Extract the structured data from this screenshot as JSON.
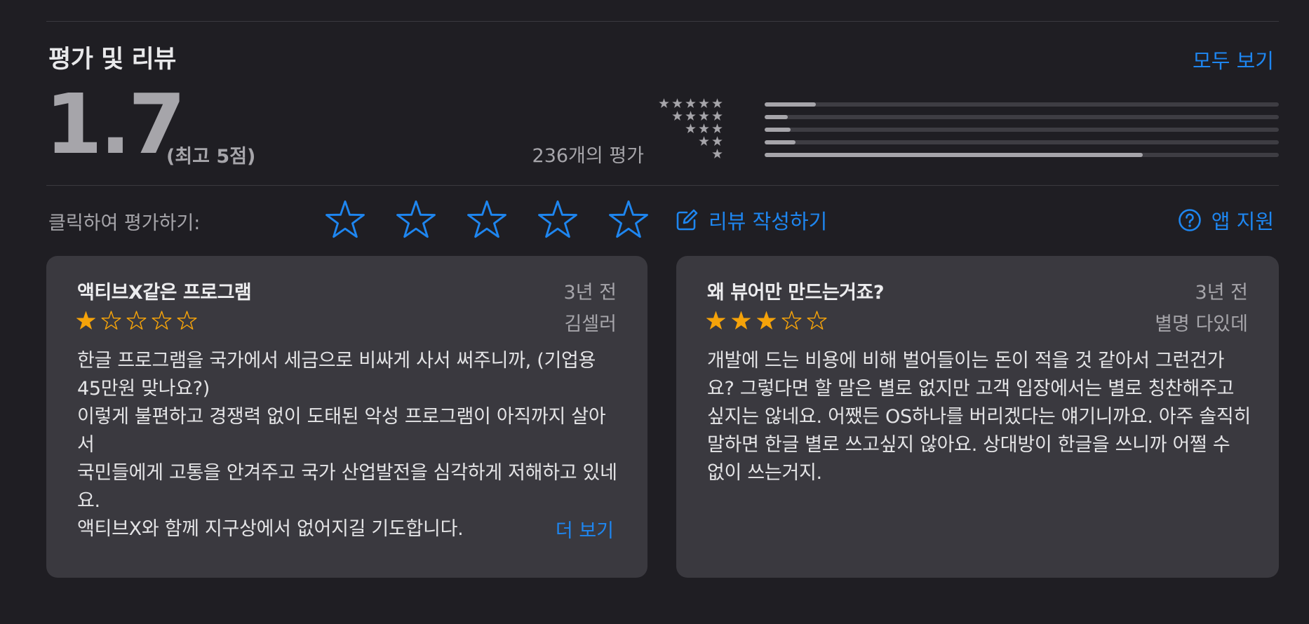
{
  "section": {
    "title": "평가 및 리뷰",
    "see_all": "모두 보기"
  },
  "summary": {
    "rating": "1.7",
    "out_of": "(최고 5점)",
    "count": "236개의 평가"
  },
  "histogram": [
    {
      "stars": 5,
      "fraction": 0.1
    },
    {
      "stars": 4,
      "fraction": 0.045
    },
    {
      "stars": 3,
      "fraction": 0.05
    },
    {
      "stars": 2,
      "fraction": 0.06
    },
    {
      "stars": 1,
      "fraction": 0.735
    }
  ],
  "tap_to_rate": {
    "label": "클릭하여 평가하기:",
    "max_stars": 5
  },
  "actions": {
    "write_review": "리뷰 작성하기",
    "app_support": "앱 지원"
  },
  "colors": {
    "accent": "#1e86f0",
    "star_orange": "#f5a30a",
    "bar_fill": "#a6a5aa",
    "bar_track": "#3e3d43",
    "card_bg": "#3a393f",
    "page_bg": "#1f1e23"
  },
  "reviews": [
    {
      "title": "액티브X같은 프로그램",
      "date": "3년 전",
      "author": "김셀러",
      "rating": 1,
      "body": "한글 프로그램을 국가에서 세금으로 비싸게 사서 써주니까, (기업용 45만원 맞나요?)\n이렇게 불편하고 경쟁력 없이 도태된 악성 프로그램이 아직까지 살아서\n국민들에게 고통을 안겨주고 국가 산업발전을 심각하게 저해하고 있네요.\n액티브X와 함께 지구상에서 없어지길 기도합니다.",
      "more": "더 보기"
    },
    {
      "title": "왜 뷰어만 만드는거죠?",
      "date": "3년 전",
      "author": "별명 다있데",
      "rating": 3,
      "body": "개발에 드는 비용에 비해 벌어들이는 돈이 적을 것 같아서 그런건가요? 그렇다면 할 말은 별로 없지만 고객 입장에서는 별로 칭찬해주고 싶지는 않네요. 어쨌든 OS하나를 버리겠다는 얘기니까요. 아주 솔직히 말하면 한글 별로 쓰고싶지 않아요. 상대방이 한글을 쓰니까 어쩔 수 없이 쓰는거지."
    }
  ],
  "icons": {
    "star_filled": "star-filled-icon",
    "star_outline": "star-outline-icon",
    "compose": "compose-icon",
    "help": "question-circle-icon"
  }
}
